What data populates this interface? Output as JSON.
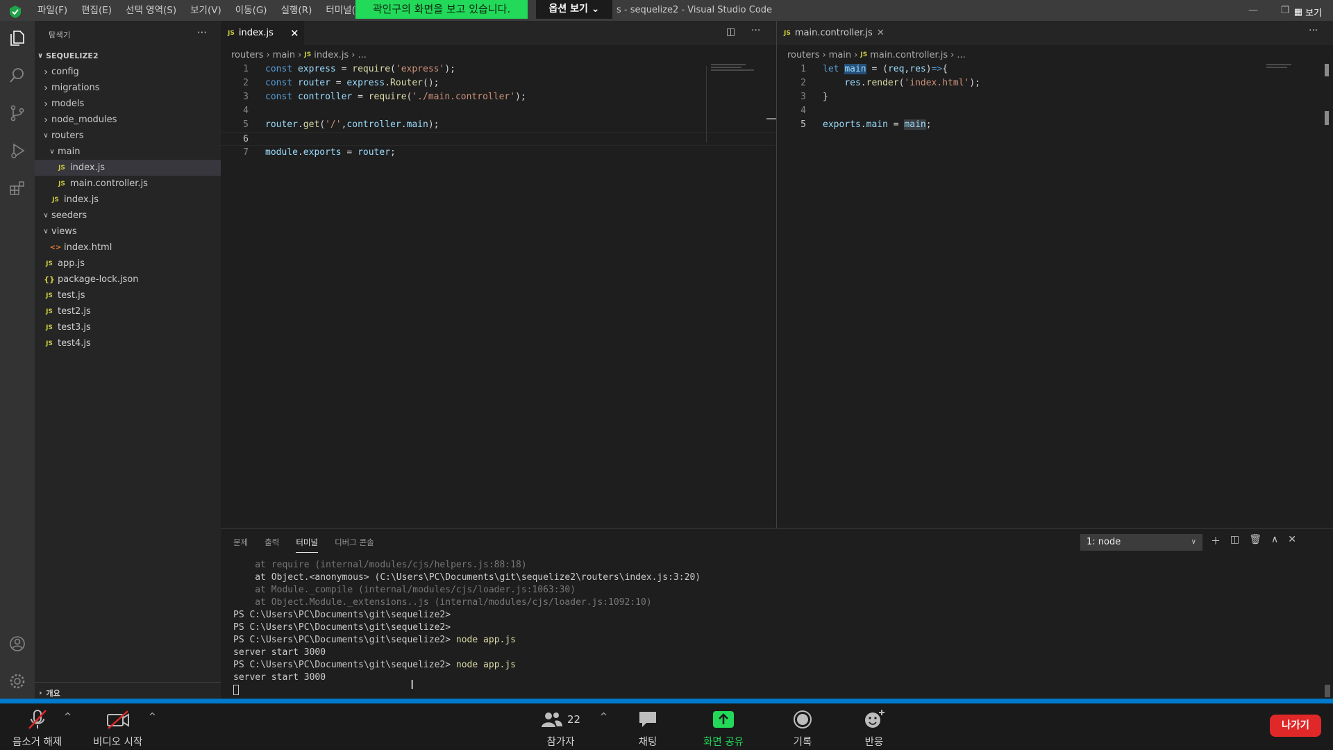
{
  "titlebar": {
    "menu": [
      "파일(F)",
      "편집(E)",
      "선택 영역(S)",
      "보기(V)",
      "이동(G)",
      "실행(R)",
      "터미널(T)"
    ],
    "share_banner": "곽인구의 화면을 보고 있습니다.",
    "view_options": "옵션 보기",
    "window_title": "s - sequelize2 - Visual Studio Code",
    "view_button": "보기"
  },
  "sidebar": {
    "title": "탐색기",
    "project": "SEQUELIZE2",
    "tree": [
      {
        "label": "config",
        "type": "folder",
        "depth": 0,
        "open": false
      },
      {
        "label": "migrations",
        "type": "folder",
        "depth": 0,
        "open": false
      },
      {
        "label": "models",
        "type": "folder",
        "depth": 0,
        "open": false
      },
      {
        "label": "node_modules",
        "type": "folder",
        "depth": 0,
        "open": false
      },
      {
        "label": "routers",
        "type": "folder",
        "depth": 0,
        "open": true
      },
      {
        "label": "main",
        "type": "folder",
        "depth": 1,
        "open": true
      },
      {
        "label": "index.js",
        "type": "js",
        "depth": 2,
        "selected": true
      },
      {
        "label": "main.controller.js",
        "type": "js",
        "depth": 2
      },
      {
        "label": "index.js",
        "type": "js",
        "depth": 1
      },
      {
        "label": "seeders",
        "type": "folder",
        "depth": 0,
        "open": true
      },
      {
        "label": "views",
        "type": "folder",
        "depth": 0,
        "open": true
      },
      {
        "label": "index.html",
        "type": "html",
        "depth": 1
      },
      {
        "label": "app.js",
        "type": "js",
        "depth": 0
      },
      {
        "label": "package-lock.json",
        "type": "json",
        "depth": 0
      },
      {
        "label": "test.js",
        "type": "js",
        "depth": 0
      },
      {
        "label": "test2.js",
        "type": "js",
        "depth": 0
      },
      {
        "label": "test3.js",
        "type": "js",
        "depth": 0
      },
      {
        "label": "test4.js",
        "type": "js",
        "depth": 0
      }
    ],
    "outline_label": "개요"
  },
  "editor_left": {
    "tab": "index.js",
    "breadcrumb": [
      "routers",
      "main",
      "index.js",
      "..."
    ],
    "current_line": 6,
    "lines": [
      [
        [
          "k",
          "const "
        ],
        [
          "v",
          "express"
        ],
        [
          "p",
          " = "
        ],
        [
          "f",
          "require"
        ],
        [
          "p",
          "("
        ],
        [
          "s",
          "'express'"
        ],
        [
          "p",
          ");"
        ]
      ],
      [
        [
          "k",
          "const "
        ],
        [
          "v",
          "router"
        ],
        [
          "p",
          " = "
        ],
        [
          "v",
          "express"
        ],
        [
          "p",
          "."
        ],
        [
          "f",
          "Router"
        ],
        [
          "p",
          "();"
        ]
      ],
      [
        [
          "k",
          "const "
        ],
        [
          "v",
          "controller"
        ],
        [
          "p",
          " = "
        ],
        [
          "f",
          "require"
        ],
        [
          "p",
          "("
        ],
        [
          "s",
          "'./main.controller'"
        ],
        [
          "p",
          ");"
        ]
      ],
      [],
      [
        [
          "v",
          "router"
        ],
        [
          "p",
          "."
        ],
        [
          "f",
          "get"
        ],
        [
          "p",
          "("
        ],
        [
          "s",
          "'/'"
        ],
        [
          "p",
          ","
        ],
        [
          "v",
          "controller"
        ],
        [
          "p",
          "."
        ],
        [
          "v",
          "main"
        ],
        [
          "p",
          ");"
        ]
      ],
      [],
      [
        [
          "v",
          "module"
        ],
        [
          "p",
          "."
        ],
        [
          "v",
          "exports"
        ],
        [
          "p",
          " = "
        ],
        [
          "v",
          "router"
        ],
        [
          "p",
          ";"
        ]
      ]
    ]
  },
  "editor_right": {
    "tab": "main.controller.js",
    "breadcrumb": [
      "routers",
      "main",
      "main.controller.js",
      "..."
    ],
    "current_line": 5,
    "lines": [
      [
        [
          "k",
          "let "
        ],
        [
          "vh",
          "main"
        ],
        [
          "p",
          " = ("
        ],
        [
          "v",
          "req"
        ],
        [
          "p",
          ","
        ],
        [
          "v",
          "res"
        ],
        [
          "p",
          ")"
        ],
        [
          "k",
          "=>"
        ],
        [
          "p",
          "{"
        ]
      ],
      [
        [
          "p",
          "    "
        ],
        [
          "v",
          "res"
        ],
        [
          "p",
          "."
        ],
        [
          "f",
          "render"
        ],
        [
          "p",
          "("
        ],
        [
          "s",
          "'index.html'"
        ],
        [
          "p",
          ");"
        ]
      ],
      [
        [
          "p",
          "}"
        ]
      ],
      [],
      [
        [
          "v",
          "exports"
        ],
        [
          "p",
          "."
        ],
        [
          "v",
          "main"
        ],
        [
          "p",
          " = "
        ],
        [
          "vh2",
          "main"
        ],
        [
          "p",
          ";"
        ]
      ]
    ]
  },
  "panel": {
    "tabs": [
      "문제",
      "출력",
      "터미널",
      "디버그 콘솔"
    ],
    "active_tab": "터미널",
    "terminal_select": "1: node",
    "terminal_lines": [
      {
        "text": "    at require (internal/modules/cjs/helpers.js:88:18)",
        "style": "dim"
      },
      {
        "text": "    at Object.<anonymous> (C:\\Users\\PC\\Documents\\git\\sequelize2\\routers\\index.js:3:20)",
        "style": "normal"
      },
      {
        "text": "    at Module._compile (internal/modules/cjs/loader.js:1063:30)",
        "style": "dim"
      },
      {
        "text": "    at Object.Module._extensions..js (internal/modules/cjs/loader.js:1092:10)",
        "style": "dim"
      },
      {
        "text": "PS C:\\Users\\PC\\Documents\\git\\sequelize2>",
        "style": "normal"
      },
      {
        "text": "PS C:\\Users\\PC\\Documents\\git\\sequelize2>",
        "style": "normal"
      },
      {
        "text": "PS C:\\Users\\PC\\Documents\\git\\sequelize2>",
        "style": "normal",
        "cmd": " node app.js"
      },
      {
        "text": "server start 3000",
        "style": "normal"
      },
      {
        "text": "PS C:\\Users\\PC\\Documents\\git\\sequelize2>",
        "style": "normal",
        "cmd": " node app.js"
      },
      {
        "text": "server start 3000",
        "style": "normal"
      }
    ]
  },
  "zoombar": {
    "mute": "음소거 해제",
    "video": "비디오 시작",
    "participants": "참가자",
    "participants_count": "22",
    "chat": "채팅",
    "share": "화면 공유",
    "record": "기록",
    "reactions": "반응",
    "leave": "나가기"
  },
  "colors": {
    "share_green": "#23d959",
    "leave_red": "#e02828",
    "statusbar_blue": "#007acc"
  }
}
